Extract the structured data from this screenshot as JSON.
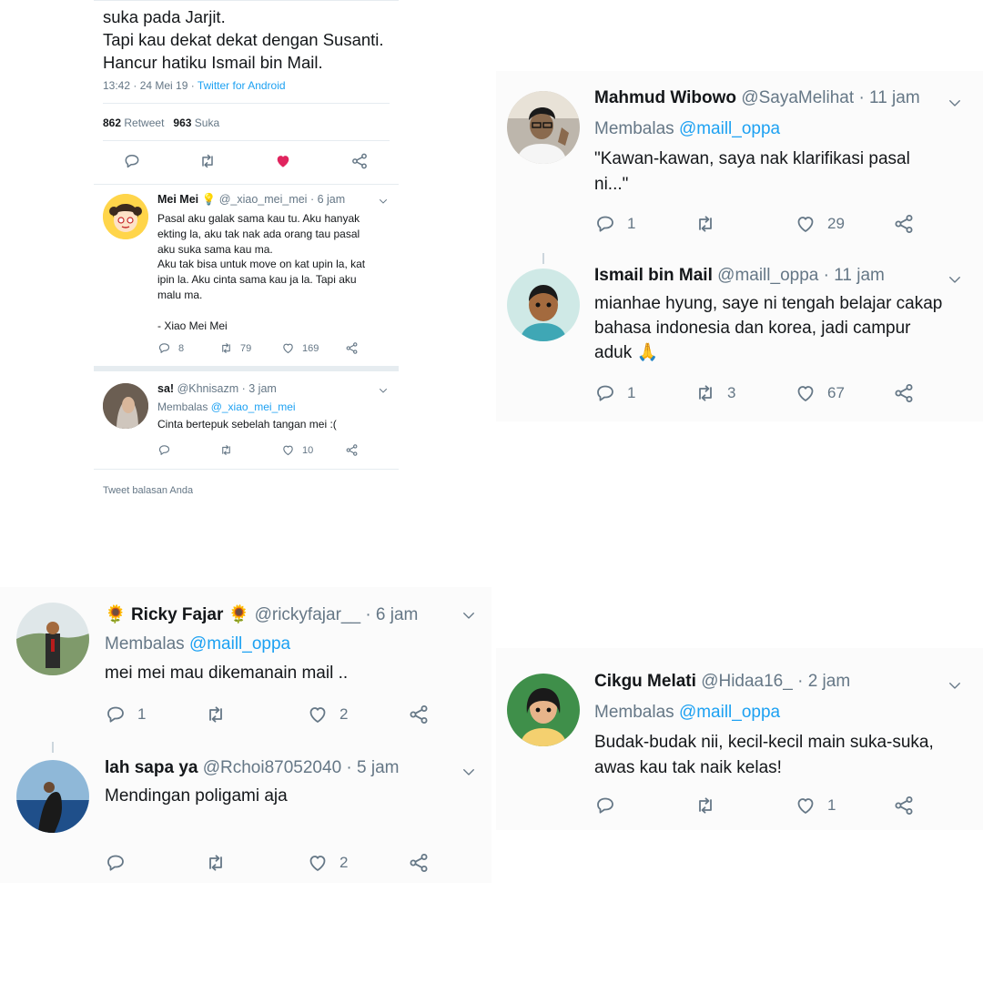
{
  "panel1": {
    "body_lines": [
      "suka pada Jarjit.",
      "Tapi kau dekat dekat dengan Susanti.",
      "Hancur hatiku Ismail bin Mail."
    ],
    "meta_time": "13:42 · 24 Mei 19 · ",
    "meta_source": "Twitter for Android",
    "retweet_count": "862",
    "retweet_label": "Retweet",
    "like_count": "963",
    "like_label": "Suka",
    "reply1": {
      "name": "Mei Mei",
      "handle": "@_xiao_mei_mei",
      "time": "· 6 jam",
      "text_lines": [
        "Pasal aku galak sama kau tu. Aku hanyak",
        "ekting la, aku tak nak ada orang tau pasal",
        "aku suka sama kau ma.",
        "Aku tak bisa untuk move on kat upin la, kat",
        "ipin la. Aku cinta sama kau ja la. Tapi aku",
        "malu ma.",
        "",
        "- Xiao Mei Mei"
      ],
      "retweets": "79",
      "likes": "169"
    },
    "reply2": {
      "name": "sa!",
      "handle": "@Khnisazm",
      "time": "· 3 jam",
      "replying": "Membalas",
      "replying_to": "@_xiao_mei_mei",
      "text": "Cinta bertepuk sebelah tangan mei :(",
      "likes": "10"
    },
    "cutoff_text": "Tweet balasan Anda"
  },
  "panel2": {
    "tweet1": {
      "name": "Mahmud Wibowo",
      "handle": "@SayaMelihat",
      "time": "· 11 jam",
      "replying": "Membalas",
      "replying_to": "@maill_oppa",
      "text_lines": [
        "\"Kawan-kawan, saya nak klarifikasi pasal",
        "ni...\""
      ],
      "replies": "1",
      "likes": "29"
    },
    "tweet2": {
      "name": "Ismail bin Mail",
      "handle": "@maill_oppa",
      "time": "· 11 jam",
      "text_lines": [
        "mianhae hyung, saye ni tengah belajar cakap",
        "bahasa indonesia dan korea, jadi campur",
        "aduk 🙏"
      ],
      "replies": "1",
      "retweets": "3",
      "likes": "67"
    }
  },
  "panel3": {
    "tweet1": {
      "name": "Ricky Fajar",
      "flower": "🌻",
      "handle": "@rickyfajar__",
      "time": "· 6 jam",
      "replying": "Membalas",
      "replying_to": "@maill_oppa",
      "text": "mei mei mau dikemanain mail ..",
      "replies": "1",
      "likes": "2"
    },
    "tweet2": {
      "name": "lah sapa ya",
      "handle": "@Rchoi87052040",
      "time": "· 5 jam",
      "text": "Mendingan poligami aja",
      "likes": "2"
    }
  },
  "panel4": {
    "tweet1": {
      "name": "Cikgu Melati",
      "handle": "@Hidaa16_",
      "time": "· 2 jam",
      "replying": "Membalas",
      "replying_to": "@maill_oppa",
      "text_lines": [
        "Budak-budak nii, kecil-kecil main suka-suka,",
        "awas kau tak naik kelas!"
      ],
      "likes": "1"
    }
  },
  "colors": {
    "link": "#1da1f2",
    "muted": "#657786",
    "heart_active": "#e0245e"
  }
}
